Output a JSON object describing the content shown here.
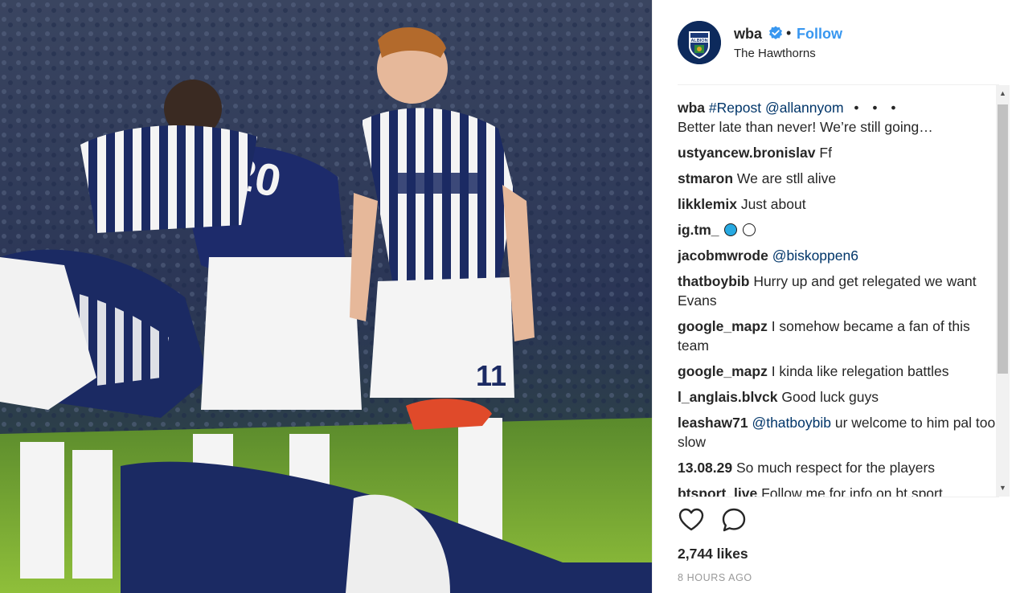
{
  "post": {
    "username": "wba",
    "follow_label": "Follow",
    "separator": "•",
    "location": "The Hawthorns",
    "verified_icon": "verified-badge-icon",
    "avatar_text": "ALBION",
    "likes": "2,744 likes",
    "timestamp": "8 HOURS AGO"
  },
  "caption": {
    "user": "wba",
    "hashtag": "#Repost",
    "mention": "@allannyom",
    "more": "• • •",
    "text": "Better late than never! We’re still going…"
  },
  "comments": [
    {
      "user": "ustyancew.bronislav",
      "text": "Ff"
    },
    {
      "user": "stmaron",
      "text": "We are stll alive"
    },
    {
      "user": "likklemix",
      "text": "Just about"
    },
    {
      "user": "ig.tm_",
      "text": ""
    },
    {
      "user": "jacobmwrode",
      "mention": "@biskoppen6",
      "text": ""
    },
    {
      "user": "thatboybib",
      "text": "Hurry up and get relegated we want Evans"
    },
    {
      "user": "google_mapz",
      "text": "I somehow became a fan of this team"
    },
    {
      "user": "google_mapz",
      "text": "I kinda like relegation battles"
    },
    {
      "user": "l_anglais.blvck",
      "text": "Good luck guys"
    },
    {
      "user": "leashaw71",
      "mention": "@thatboybib",
      "text": "ur welcome to him pal too slow"
    },
    {
      "user": "13.08.29",
      "text": "So much respect for the players"
    },
    {
      "user": "btsport_live",
      "text": "Follow me for info on bt sport"
    }
  ],
  "icons": {
    "like": "heart-icon",
    "comment": "comment-bubble-icon",
    "scroll_up": "▲",
    "scroll_down": "▼"
  },
  "colors": {
    "link": "#003569",
    "follow": "#3897f0",
    "verified": "#3897f0",
    "secondary_text": "#999999"
  }
}
